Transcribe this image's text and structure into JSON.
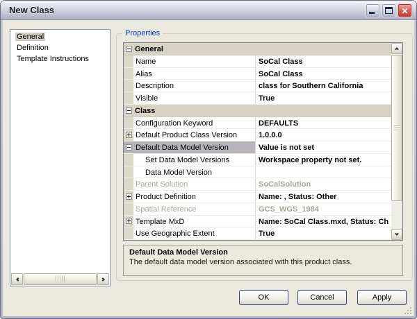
{
  "window": {
    "title": "New Class",
    "controls": [
      "minimize",
      "maximize",
      "close"
    ]
  },
  "sidebar": {
    "items": [
      {
        "label": "General",
        "selected": true
      },
      {
        "label": "Definition",
        "selected": false
      },
      {
        "label": "Template Instructions",
        "selected": false
      }
    ]
  },
  "properties_group": {
    "label": "Properties"
  },
  "grid": {
    "rows": [
      {
        "type": "category",
        "expand": "minus",
        "label": "General",
        "value": ""
      },
      {
        "type": "prop",
        "label": "Name",
        "value": "SoCal Class"
      },
      {
        "type": "prop",
        "label": "Alias",
        "value": "SoCal Class"
      },
      {
        "type": "prop",
        "label": "Description",
        "value": "class for Southern California"
      },
      {
        "type": "prop",
        "label": "Visible",
        "value": "True"
      },
      {
        "type": "category",
        "expand": "minus",
        "label": "Class",
        "value": ""
      },
      {
        "type": "prop",
        "label": "Configuration Keyword",
        "value": "DEFAULTS"
      },
      {
        "type": "prop",
        "expand": "plus",
        "label": "Default Product Class Version",
        "value": "1.0.0.0"
      },
      {
        "type": "prop",
        "expand": "minus",
        "label": "Default Data Model Version",
        "value": "Value is not set",
        "selected": true
      },
      {
        "type": "prop",
        "indent": true,
        "label": "Set Data Model Versions",
        "value": "Workspace property not set."
      },
      {
        "type": "prop",
        "indent": true,
        "label": "Data Model Version",
        "value": ""
      },
      {
        "type": "prop",
        "label": "Parent Solution",
        "value": "SoCalSolution",
        "disabled": true
      },
      {
        "type": "prop",
        "expand": "plus",
        "label": "Product Definition",
        "value": "Name: , Status: Other"
      },
      {
        "type": "prop",
        "label": "Spatial Reference",
        "value": "GCS_WGS_1984",
        "disabled": true
      },
      {
        "type": "prop",
        "expand": "plus",
        "label": "Template MxD",
        "value": "Name: SoCal Class.mxd, Status: Ch"
      },
      {
        "type": "prop",
        "label": "Use Geographic Extent",
        "value": "True"
      }
    ]
  },
  "description_panel": {
    "title": "Default Data Model Version",
    "text": "The default data model version associated with this product class."
  },
  "buttons": {
    "ok": "OK",
    "cancel": "Cancel",
    "apply": "Apply"
  },
  "icons": {
    "expand_collapsed": "plus-box",
    "expand_expanded": "minus-box",
    "scrollbar": [
      "chevron-up",
      "chevron-down",
      "chevron-left",
      "chevron-right"
    ]
  },
  "colors": {
    "dialog_face": "#ebe8de",
    "titlebar_silver": "#c3c3d6",
    "close_button_red": "#c53a2f",
    "groupbox_label_blue": "#0135cc",
    "category_row_bg": "#d8d4c5",
    "selected_row_bg": "#b6b4ba",
    "disabled_text": "#a8a499",
    "button_border_blue": "#33477a"
  }
}
